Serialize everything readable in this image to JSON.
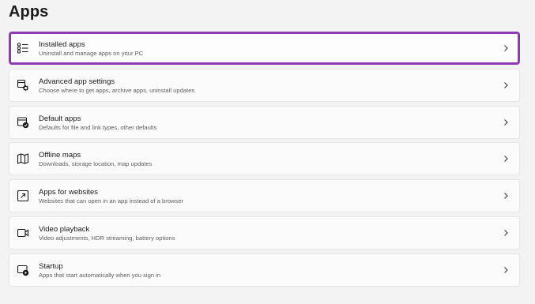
{
  "page": {
    "title": "Apps"
  },
  "items": [
    {
      "title": "Installed apps",
      "description": "Uninstall and manage apps on your PC",
      "icon": "installed-apps-icon",
      "highlighted": true
    },
    {
      "title": "Advanced app settings",
      "description": "Choose where to get apps, archive apps, uninstall updates",
      "icon": "advanced-app-settings-icon",
      "highlighted": false
    },
    {
      "title": "Default apps",
      "description": "Defaults for file and link types, other defaults",
      "icon": "default-apps-icon",
      "highlighted": false
    },
    {
      "title": "Offline maps",
      "description": "Downloads, storage location, map updates",
      "icon": "offline-maps-icon",
      "highlighted": false
    },
    {
      "title": "Apps for websites",
      "description": "Websites that can open in an app instead of a browser",
      "icon": "apps-for-websites-icon",
      "highlighted": false
    },
    {
      "title": "Video playback",
      "description": "Video adjustments, HDR streaming, battery options",
      "icon": "video-playback-icon",
      "highlighted": false
    },
    {
      "title": "Startup",
      "description": "Apps that start automatically when you sign in",
      "icon": "startup-icon",
      "highlighted": false
    }
  ],
  "colors": {
    "highlight_border": "#8e3bb1",
    "background": "#f3f3f3",
    "card": "#fbfbfb"
  }
}
